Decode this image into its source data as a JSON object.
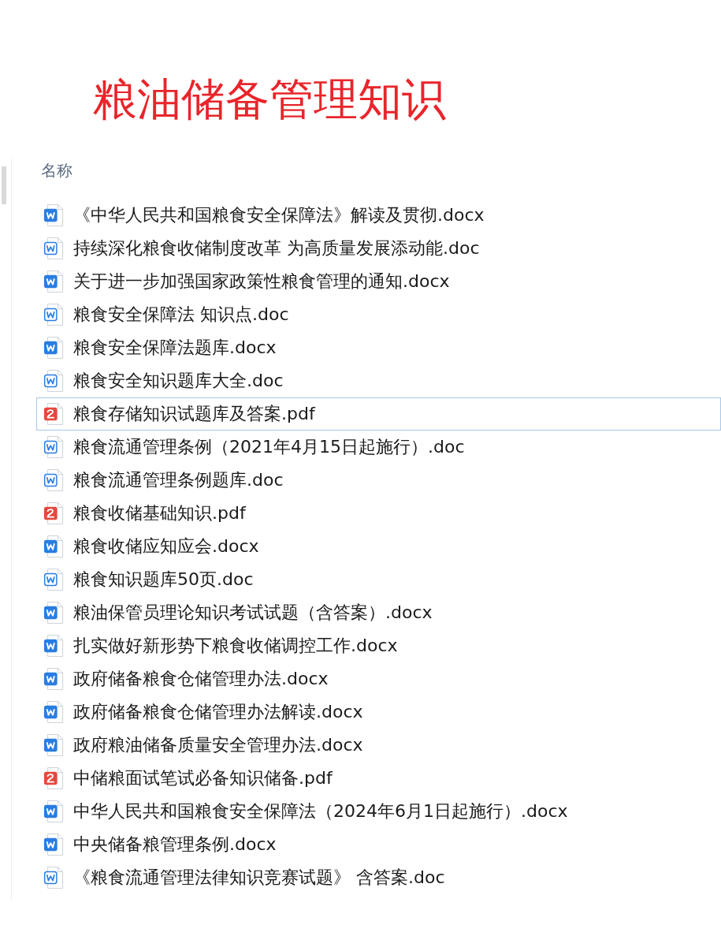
{
  "title": "粮油储备管理知识",
  "list_header": "名称",
  "files": [
    {
      "name": "《中华人民共和国粮食安全保障法》解读及贯彻.docx",
      "kind": "docx",
      "selected": false
    },
    {
      "name": "持续深化粮食收储制度改革 为高质量发展添动能.doc",
      "kind": "doc",
      "selected": false
    },
    {
      "name": "关于进一步加强国家政策性粮食管理的通知.docx",
      "kind": "docx",
      "selected": false
    },
    {
      "name": "粮食安全保障法 知识点.doc",
      "kind": "doc",
      "selected": false
    },
    {
      "name": "粮食安全保障法题库.docx",
      "kind": "docx",
      "selected": false
    },
    {
      "name": "粮食安全知识题库大全.doc",
      "kind": "doc",
      "selected": false
    },
    {
      "name": "粮食存储知识试题库及答案.pdf",
      "kind": "pdf",
      "selected": true
    },
    {
      "name": "粮食流通管理条例（2021年4月15日起施行）.doc",
      "kind": "doc",
      "selected": false
    },
    {
      "name": "粮食流通管理条例题库.doc",
      "kind": "doc",
      "selected": false
    },
    {
      "name": "粮食收储基础知识.pdf",
      "kind": "pdf",
      "selected": false
    },
    {
      "name": "粮食收储应知应会.docx",
      "kind": "docx",
      "selected": false
    },
    {
      "name": "粮食知识题库50页.doc",
      "kind": "doc",
      "selected": false
    },
    {
      "name": "粮油保管员理论知识考试试题（含答案）.docx",
      "kind": "docx",
      "selected": false
    },
    {
      "name": "扎实做好新形势下粮食收储调控工作.docx",
      "kind": "docx",
      "selected": false
    },
    {
      "name": "政府储备粮食仓储管理办法.docx",
      "kind": "docx",
      "selected": false
    },
    {
      "name": "政府储备粮食仓储管理办法解读.docx",
      "kind": "docx",
      "selected": false
    },
    {
      "name": "政府粮油储备质量安全管理办法.docx",
      "kind": "docx",
      "selected": false
    },
    {
      "name": "中储粮面试笔试必备知识储备.pdf",
      "kind": "pdf",
      "selected": false
    },
    {
      "name": "中华人民共和国粮食安全保障法（2024年6月1日起施行）.docx",
      "kind": "docx",
      "selected": false
    },
    {
      "name": "中央储备粮管理条例.docx",
      "kind": "docx",
      "selected": false
    },
    {
      "name": "《粮食流通管理法律知识竞赛试题》 含答案.doc",
      "kind": "doc",
      "selected": false
    }
  ]
}
